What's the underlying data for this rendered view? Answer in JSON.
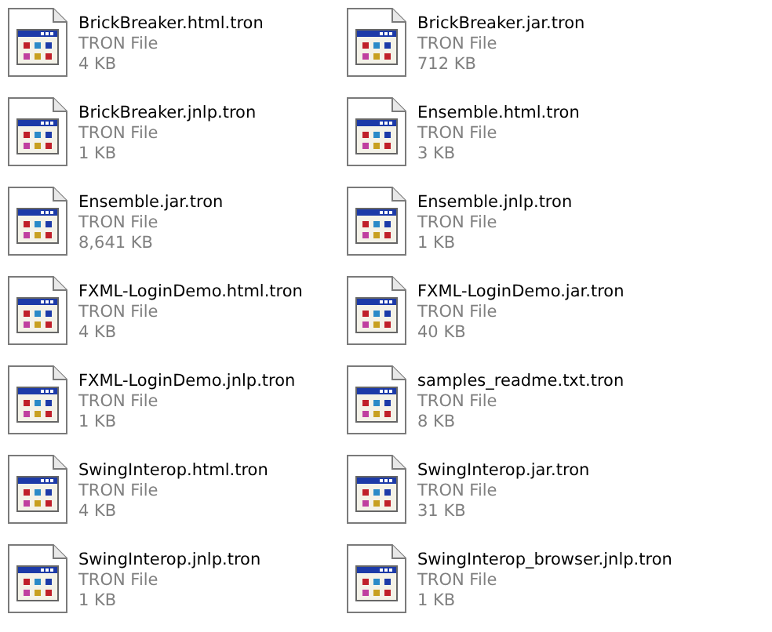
{
  "files": [
    {
      "name": "BrickBreaker.html.tron",
      "type": "TRON File",
      "size": "4 KB"
    },
    {
      "name": "BrickBreaker.jar.tron",
      "type": "TRON File",
      "size": "712 KB"
    },
    {
      "name": "BrickBreaker.jnlp.tron",
      "type": "TRON File",
      "size": "1 KB"
    },
    {
      "name": "Ensemble.html.tron",
      "type": "TRON File",
      "size": "3 KB"
    },
    {
      "name": "Ensemble.jar.tron",
      "type": "TRON File",
      "size": "8,641 KB"
    },
    {
      "name": "Ensemble.jnlp.tron",
      "type": "TRON File",
      "size": "1 KB"
    },
    {
      "name": "FXML-LoginDemo.html.tron",
      "type": "TRON File",
      "size": "4 KB"
    },
    {
      "name": "FXML-LoginDemo.jar.tron",
      "type": "TRON File",
      "size": "40 KB"
    },
    {
      "name": "FXML-LoginDemo.jnlp.tron",
      "type": "TRON File",
      "size": "1 KB"
    },
    {
      "name": "samples_readme.txt.tron",
      "type": "TRON File",
      "size": "8 KB"
    },
    {
      "name": "SwingInterop.html.tron",
      "type": "TRON File",
      "size": "4 KB"
    },
    {
      "name": "SwingInterop.jar.tron",
      "type": "TRON File",
      "size": "31 KB"
    },
    {
      "name": "SwingInterop.jnlp.tron",
      "type": "TRON File",
      "size": "1 KB"
    },
    {
      "name": "SwingInterop_browser.jnlp.tron",
      "type": "TRON File",
      "size": "1 KB"
    }
  ]
}
